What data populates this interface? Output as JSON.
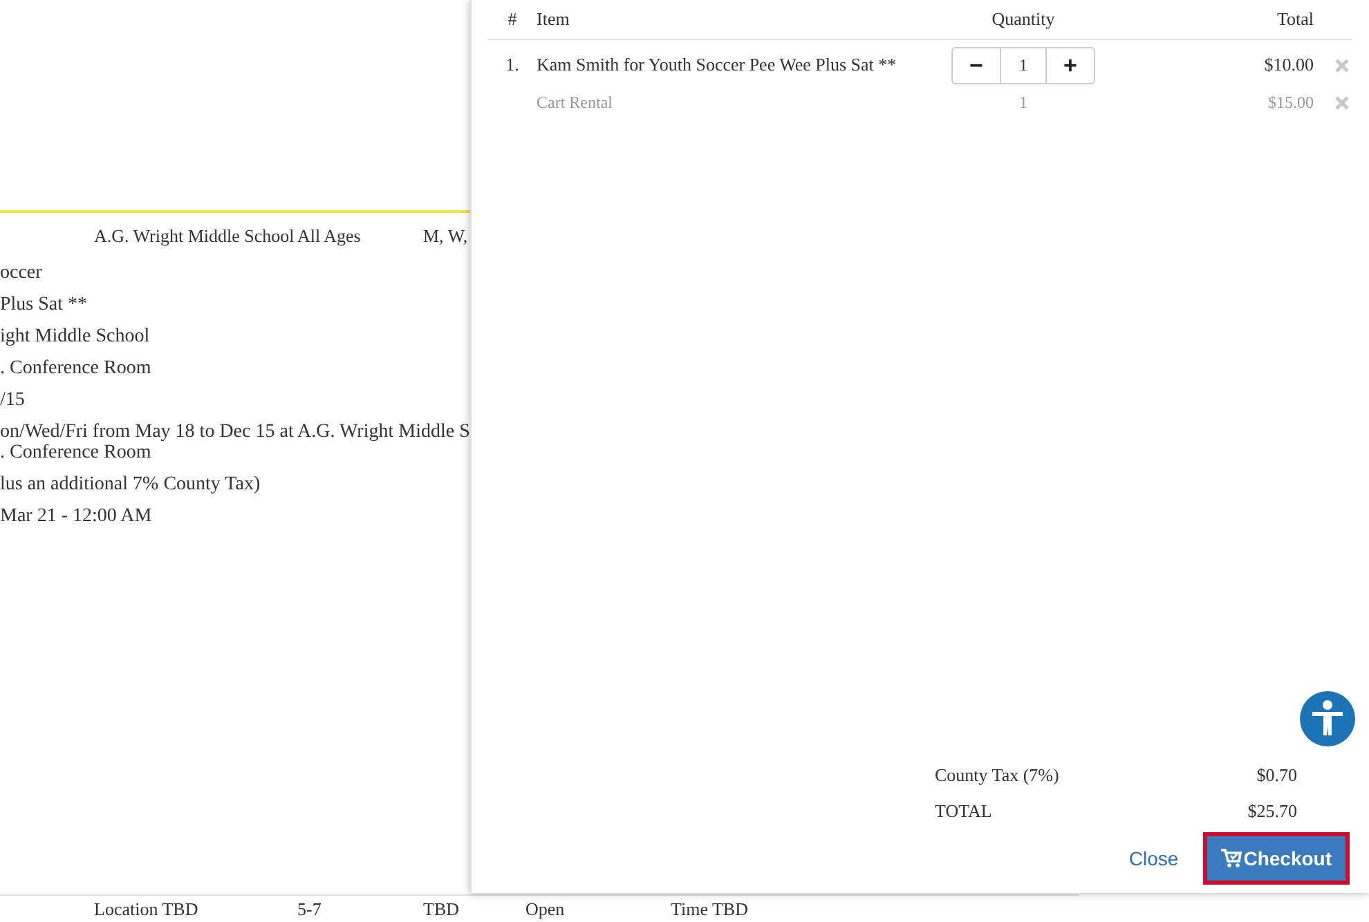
{
  "background": {
    "summary_row": [
      "A.G. Wright Middle School",
      "All Ages",
      "M, W,"
    ],
    "details": [
      {
        "lines": [
          "occer"
        ]
      },
      {
        "lines": [
          "Plus Sat **"
        ]
      },
      {
        "lines": [
          "ight Middle School"
        ]
      },
      {
        "lines": [
          ". Conference Room"
        ]
      },
      {
        "lines": [
          "/15"
        ]
      },
      {
        "lines": [
          "on/Wed/Fri from May 18 to Dec 15 at A.G. Wright Middle S",
          ". Conference Room"
        ]
      },
      {
        "lines": [
          "lus an additional 7% County Tax)"
        ]
      },
      {
        "lines": [
          "Mar 21 - 12:00 AM"
        ]
      }
    ],
    "bottom_row": [
      "Location TBD",
      "5-7",
      "TBD",
      "Open",
      "Time TBD"
    ]
  },
  "cart": {
    "columns": [
      "#",
      "Item",
      "Quantity",
      "Total"
    ],
    "rows": [
      {
        "kind": "stepper",
        "number": "1.",
        "item": "Kam Smith for Youth Soccer Pee Wee Plus Sat **",
        "minus": "−",
        "quantity": "1",
        "plus": "+",
        "total": "$10.00"
      },
      {
        "kind": "fixed",
        "item": "Cart Rental",
        "quantity": "1",
        "total": "$15.00"
      }
    ],
    "summary": [
      {
        "label": "County Tax (7%)",
        "value": "$0.70"
      },
      {
        "label": "TOTAL",
        "value": "$25.70"
      }
    ],
    "close": "Close",
    "checkout": "Checkout"
  }
}
